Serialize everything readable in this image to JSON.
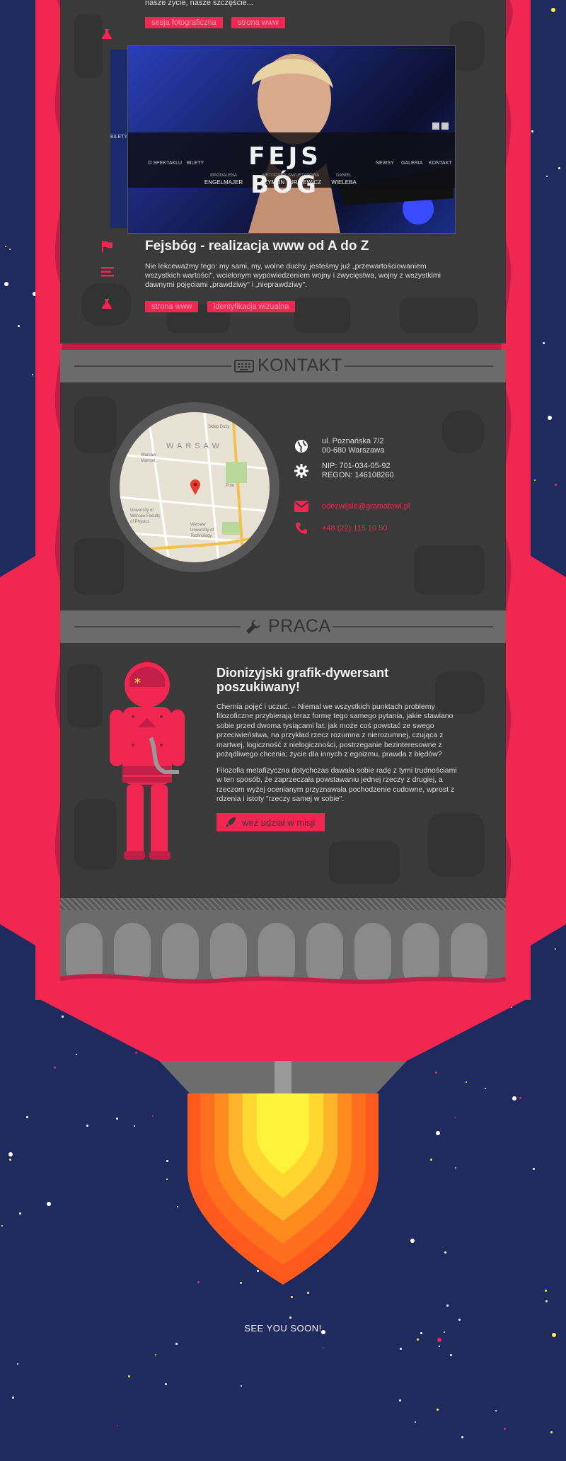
{
  "portfolio_top": {
    "teaser_text": "nasze życie, nasze szczęście...",
    "tags": [
      "sesja fotograficzna",
      "strona www"
    ]
  },
  "project": {
    "title": "Fejsbóg - realizacja www od A do Z",
    "description": "Nie lekceważmy tego: my sami, my, wolne duchy, jesteśmy już „przewartościowaniem wszystkich wartości\", wcielonym wypowiedzeniem wojny i zwycięstwa, wojny z wszystkimi dawnymi pojęciami „prawdziwy\" i „nieprawdziwy\".",
    "tags": [
      "strona www",
      "identyfikacja wizualna"
    ],
    "screenshot": {
      "logo": "FEJS BÓG",
      "nav_left": [
        "O SPEKTAKLU",
        "BILETY"
      ],
      "nav_right": [
        "NEWSY",
        "GALERIA",
        "KONTAKT"
      ],
      "credits": [
        {
          "role": "MAGDALENA",
          "name": "ENGELMAJER"
        },
        {
          "role": "METODYKA: DWUETAPOWA",
          "name": "SZYMON TURKIEWICZ"
        },
        {
          "role": "DANIEL",
          "name": "WIELEBA"
        }
      ],
      "back_label": "BILETY"
    }
  },
  "contact": {
    "heading": "KONTAKT",
    "map_label": "WARSAW",
    "map_places": [
      "Warsaw Marriott Hotel",
      "University of Warsaw Faculty of Physics",
      "Warsaw University of Technology",
      "Pole Mokotowskie",
      "Sklep Duży"
    ],
    "address_line1": "ul. Poznańska 7/2",
    "address_line2": "00-680 Warszawa",
    "nip": "NIP: 701-034-05-92",
    "regon": "REGON: 146108260",
    "email": "odezwijsie@gramatowi.pl",
    "phone": "+48 (22) 115 10 50"
  },
  "jobs": {
    "heading": "PRACA",
    "title": "Dionizyjski grafik-dywersant poszukiwany!",
    "paragraph1": "Chernia pojęć i uczuć. – Niemal we wszystkich punktach problemy filozoficzne przybierają teraz formę tego samego pytania, jakie stawiano sobie przed dwoma tysiącami lat: jak może coś powstać ze swego przeciwieństwa, na przykład rzecz rozumna z nierozumnej, czująca z martwej, logiczność z nielogiczności, postrzeganie bezinteresowne z pożądliwego chcenia; życie dla innych z egoizmu, prawda z błędów?",
    "paragraph2": "Filozofia metafizyczna dotychczas dawała sobie radę z tymi trudnościami w ten sposób, że zaprzeczała powstawaniu jednej rzeczy z drugiej, a rzeczom wyżej ocenianym przyznawała pochodzenie cudowne, wprost z rdzenia i istoty \"rzeczy samej w sobie\".",
    "cta_label": "weź udział w misji"
  },
  "footer": {
    "text": "SEE YOU SOON!"
  },
  "colors": {
    "space": "#1f2b5e",
    "rocket_red": "#ef2751",
    "rocket_dark_red": "#c21f48",
    "panel": "#3a3a3a",
    "header_band": "#6b6b6b",
    "flame_yellow": "#fff23a",
    "flame_orange": "#ff8a1d"
  },
  "icons": [
    "flask-icon",
    "flag-icon",
    "list-icon",
    "keyboard-icon",
    "globe-icon",
    "gear-icon",
    "envelope-icon",
    "phone-icon",
    "wrench-icon",
    "rocket-icon"
  ]
}
